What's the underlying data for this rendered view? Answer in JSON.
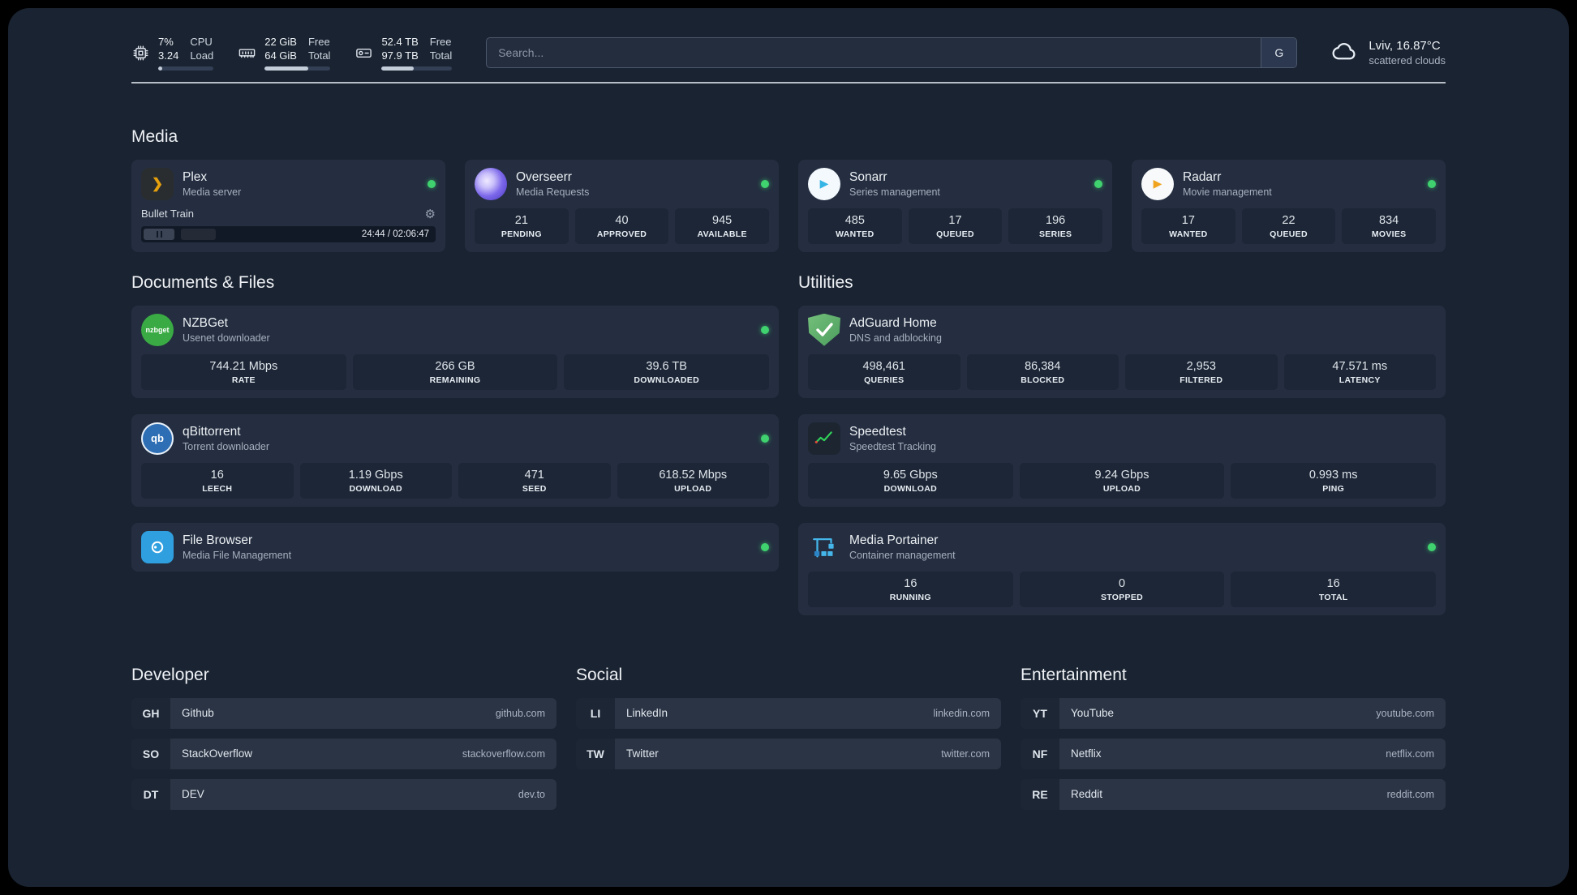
{
  "colors": {
    "status_online": "#3fd26f",
    "plex_accent": "#e5a00d",
    "speedtest_line": "#30d158"
  },
  "topbar": {
    "cpu": {
      "icon": "cpu-chip",
      "value": "7%",
      "load": "3.24",
      "label_top": "CPU",
      "label_bottom": "Load",
      "bar_percent": 7
    },
    "memory": {
      "icon": "memory-stick",
      "free": "22 GiB",
      "total": "64 GiB",
      "label_top": "Free",
      "label_bottom": "Total",
      "bar_percent": 66
    },
    "storage": {
      "icon": "hard-drive",
      "free": "52.4 TB",
      "total": "97.9 TB",
      "label_top": "Free",
      "label_bottom": "Total",
      "bar_percent": 46
    },
    "search": {
      "placeholder": "Search...",
      "provider_button": "G"
    },
    "weather": {
      "icon": "cloud",
      "location": "Lviv, 16.87°C",
      "condition": "scattered clouds"
    }
  },
  "sections": {
    "media": "Media",
    "documents": "Documents & Files",
    "utilities": "Utilities",
    "developer": "Developer",
    "social": "Social",
    "entertainment": "Entertainment"
  },
  "services": {
    "plex": {
      "name": "Plex",
      "desc": "Media server",
      "icon": "plex",
      "player": {
        "title": "Bullet Train",
        "time": "24:44 / 02:06:47",
        "progress_percent": 20
      }
    },
    "overseerr": {
      "name": "Overseerr",
      "desc": "Media Requests",
      "icon": "overseerr",
      "stats": [
        {
          "value": "21",
          "label": "PENDING"
        },
        {
          "value": "40",
          "label": "APPROVED"
        },
        {
          "value": "945",
          "label": "AVAILABLE"
        }
      ]
    },
    "sonarr": {
      "name": "Sonarr",
      "desc": "Series management",
      "icon": "sonarr",
      "stats": [
        {
          "value": "485",
          "label": "WANTED"
        },
        {
          "value": "17",
          "label": "QUEUED"
        },
        {
          "value": "196",
          "label": "SERIES"
        }
      ]
    },
    "radarr": {
      "name": "Radarr",
      "desc": "Movie management",
      "icon": "radarr",
      "stats": [
        {
          "value": "17",
          "label": "WANTED"
        },
        {
          "value": "22",
          "label": "QUEUED"
        },
        {
          "value": "834",
          "label": "MOVIES"
        }
      ]
    },
    "nzbget": {
      "name": "NZBGet",
      "desc": "Usenet downloader",
      "icon": "nzbget",
      "stats": [
        {
          "value": "744.21 Mbps",
          "label": "RATE"
        },
        {
          "value": "266 GB",
          "label": "REMAINING"
        },
        {
          "value": "39.6 TB",
          "label": "DOWNLOADED"
        }
      ]
    },
    "qbittorrent": {
      "name": "qBittorrent",
      "desc": "Torrent downloader",
      "icon": "qbittorrent",
      "stats": [
        {
          "value": "16",
          "label": "LEECH"
        },
        {
          "value": "1.19 Gbps",
          "label": "DOWNLOAD"
        },
        {
          "value": "471",
          "label": "SEED"
        },
        {
          "value": "618.52 Mbps",
          "label": "UPLOAD"
        }
      ]
    },
    "filebrowser": {
      "name": "File Browser",
      "desc": "Media File Management",
      "icon": "filebrowser"
    },
    "adguard": {
      "name": "AdGuard Home",
      "desc": "DNS and adblocking",
      "icon": "adguard-shield",
      "stats": [
        {
          "value": "498,461",
          "label": "QUERIES"
        },
        {
          "value": "86,384",
          "label": "BLOCKED"
        },
        {
          "value": "2,953",
          "label": "FILTERED"
        },
        {
          "value": "47.571 ms",
          "label": "LATENCY"
        }
      ]
    },
    "speedtest": {
      "name": "Speedtest",
      "desc": "Speedtest Tracking",
      "icon": "speedtest-graph",
      "stats": [
        {
          "value": "9.65 Gbps",
          "label": "DOWNLOAD"
        },
        {
          "value": "9.24 Gbps",
          "label": "UPLOAD"
        },
        {
          "value": "0.993 ms",
          "label": "PING"
        }
      ]
    },
    "portainer": {
      "name": "Media Portainer",
      "desc": "Container management",
      "icon": "portainer-crane",
      "stats": [
        {
          "value": "16",
          "label": "RUNNING"
        },
        {
          "value": "0",
          "label": "STOPPED"
        },
        {
          "value": "16",
          "label": "TOTAL"
        }
      ]
    }
  },
  "bookmarks": {
    "developer": [
      {
        "abbr": "GH",
        "name": "Github",
        "domain": "github.com"
      },
      {
        "abbr": "SO",
        "name": "StackOverflow",
        "domain": "stackoverflow.com"
      },
      {
        "abbr": "DT",
        "name": "DEV",
        "domain": "dev.to"
      }
    ],
    "social": [
      {
        "abbr": "LI",
        "name": "LinkedIn",
        "domain": "linkedin.com"
      },
      {
        "abbr": "TW",
        "name": "Twitter",
        "domain": "twitter.com"
      }
    ],
    "entertainment": [
      {
        "abbr": "YT",
        "name": "YouTube",
        "domain": "youtube.com"
      },
      {
        "abbr": "NF",
        "name": "Netflix",
        "domain": "netflix.com"
      },
      {
        "abbr": "RE",
        "name": "Reddit",
        "domain": "reddit.com"
      }
    ]
  }
}
